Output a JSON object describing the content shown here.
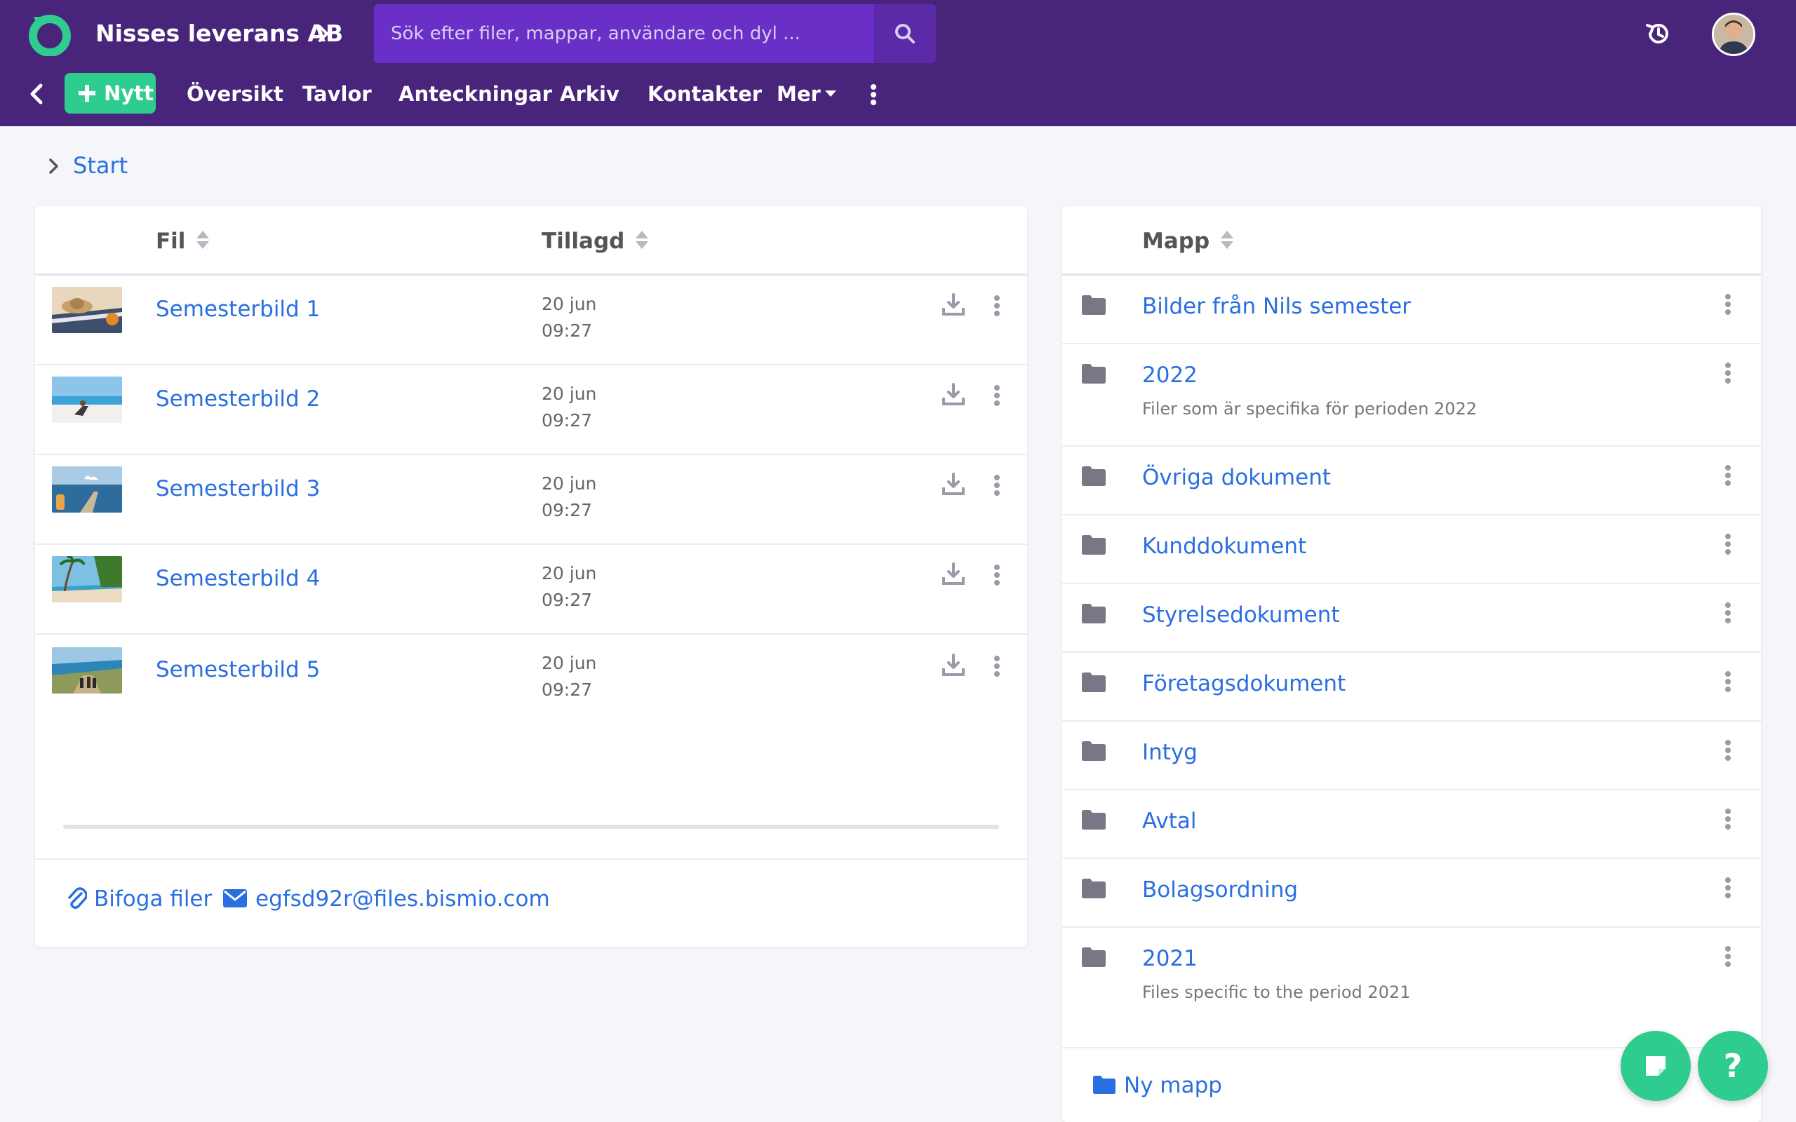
{
  "header": {
    "company": "Nisses leverans AB",
    "search_placeholder": "Sök efter filer, mappar, användare och dyl ..."
  },
  "nav": {
    "new_label": "Nytt",
    "items": [
      "Översikt",
      "Tavlor",
      "Anteckningar",
      "Arkiv",
      "Kontakter",
      "Mer"
    ]
  },
  "breadcrumb": {
    "label": "Start"
  },
  "files": {
    "col_file": "Fil",
    "col_added": "Tillagd",
    "rows": [
      {
        "name": "Semesterbild 1",
        "date": "20 jun",
        "time": "09:27"
      },
      {
        "name": "Semesterbild 2",
        "date": "20 jun",
        "time": "09:27"
      },
      {
        "name": "Semesterbild 3",
        "date": "20 jun",
        "time": "09:27"
      },
      {
        "name": "Semesterbild 4",
        "date": "20 jun",
        "time": "09:27"
      },
      {
        "name": "Semesterbild 5",
        "date": "20 jun",
        "time": "09:27"
      }
    ],
    "attach_label": "Bifoga filer",
    "email": "egfsd92r@files.bismio.com"
  },
  "folders": {
    "col_folder": "Mapp",
    "rows": [
      {
        "name": "Bilder från Nils semester",
        "desc": ""
      },
      {
        "name": "2022",
        "desc": "Filer som är specifika för perioden 2022"
      },
      {
        "name": "Övriga dokument",
        "desc": ""
      },
      {
        "name": "Kunddokument",
        "desc": ""
      },
      {
        "name": "Styrelsedokument",
        "desc": ""
      },
      {
        "name": "Företagsdokument",
        "desc": ""
      },
      {
        "name": "Intyg",
        "desc": ""
      },
      {
        "name": "Avtal",
        "desc": ""
      },
      {
        "name": "Bolagsordning",
        "desc": ""
      },
      {
        "name": "2021",
        "desc": "Files specific to the period 2021"
      }
    ],
    "new_folder_label": "Ny mapp"
  },
  "fab": {
    "help_label": "?"
  },
  "colors": {
    "header": "#48247a",
    "search": "#6a2fc7",
    "accent": "#2ecc8f",
    "link": "#2a6fe0"
  }
}
